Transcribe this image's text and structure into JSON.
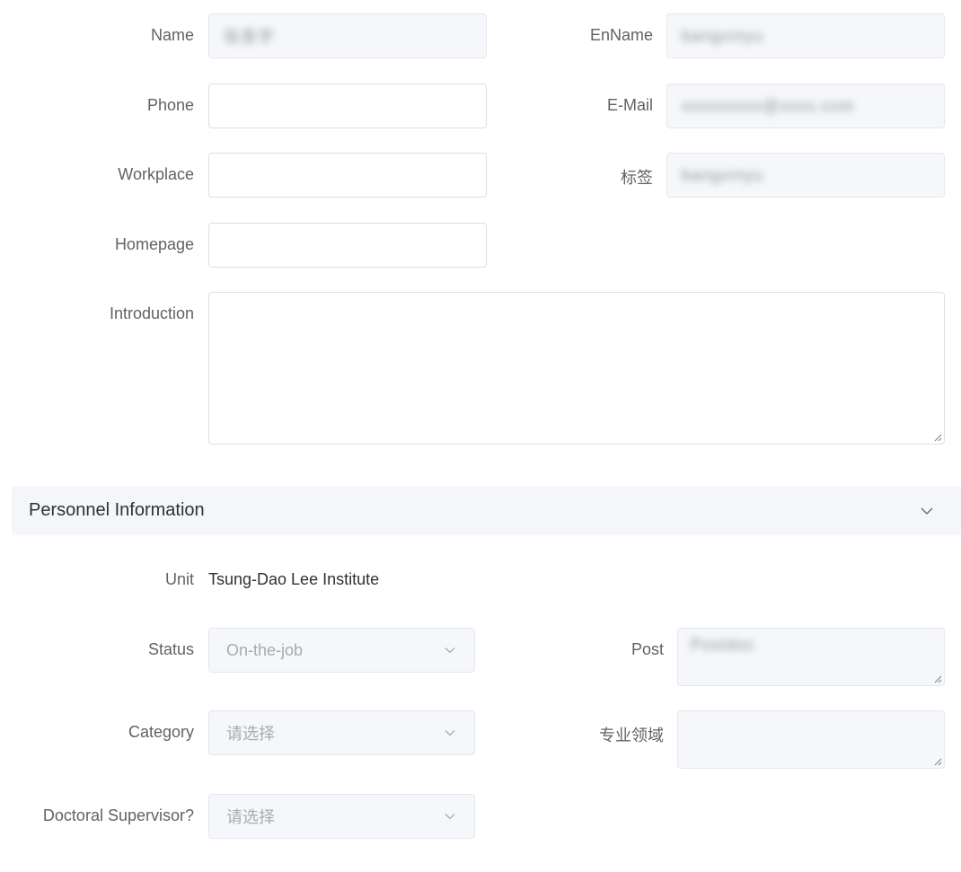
{
  "form": {
    "name": {
      "label": "Name",
      "value": "信息宇"
    },
    "enname": {
      "label": "EnName",
      "value": "bangxinyu"
    },
    "phone": {
      "label": "Phone",
      "value": ""
    },
    "email": {
      "label": "E-Mail",
      "value": "xxxxxxxxx@xxxx.com"
    },
    "workplace": {
      "label": "Workplace",
      "value": ""
    },
    "tag": {
      "label": "标签",
      "value": "bangxinyu"
    },
    "homepage": {
      "label": "Homepage",
      "value": ""
    },
    "introduction": {
      "label": "Introduction",
      "value": ""
    }
  },
  "personnel": {
    "section_title": "Personnel Information",
    "unit": {
      "label": "Unit",
      "value": "Tsung-Dao Lee Institute"
    },
    "status": {
      "label": "Status",
      "value": "On-the-job"
    },
    "post": {
      "label": "Post",
      "value": "Postdoc"
    },
    "category": {
      "label": "Category",
      "placeholder": "请选择"
    },
    "field": {
      "label": "专业领域",
      "value": ""
    },
    "doctoral_supervisor": {
      "label": "Doctoral Supervisor?",
      "placeholder": "请选择"
    }
  },
  "colors": {
    "border": "#dcdfe6",
    "disabled_bg": "#f5f7fa",
    "label_text": "#606266",
    "section_bg": "#f4f6fa"
  }
}
